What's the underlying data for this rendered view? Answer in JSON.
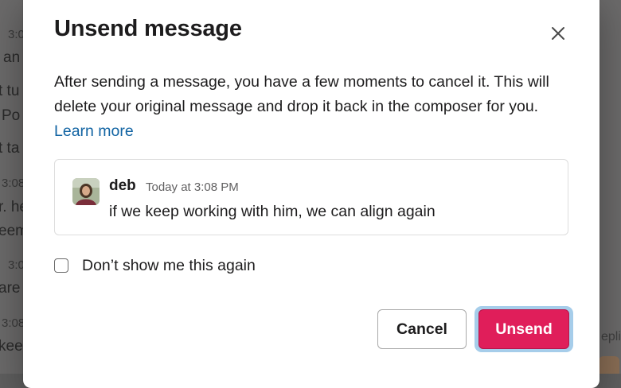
{
  "background": {
    "fragments": [
      {
        "text": "3:0",
        "kind": "time"
      },
      {
        "text": "an",
        "kind": "text"
      },
      {
        "text": "t tu",
        "kind": "text"
      },
      {
        "text": "Po",
        "kind": "text"
      },
      {
        "text": "t ta",
        "kind": "text"
      },
      {
        "text": "3:08",
        "kind": "time"
      },
      {
        "text": "r. he",
        "kind": "text"
      },
      {
        "text": "eem",
        "kind": "text"
      },
      {
        "text": "3:0",
        "kind": "time"
      },
      {
        "text": "are",
        "kind": "text"
      },
      {
        "text": "3:08",
        "kind": "time"
      },
      {
        "text": "keep",
        "kind": "text"
      },
      {
        "text": "eplie",
        "kind": "right"
      }
    ]
  },
  "dialog": {
    "title": "Unsend message",
    "close_icon": "close-x-icon",
    "description": "After sending a message, you have a few moments to cancel it. This will delete your original message and drop it back in the composer for you.",
    "learn_more": "Learn more",
    "message": {
      "author": "deb",
      "timestamp": "Today at 3:08 PM",
      "text": "if we keep working with him, we can align again"
    },
    "checkbox_label": "Don’t show me this again",
    "checkbox_checked": false,
    "cancel_label": "Cancel",
    "confirm_label": "Unsend"
  },
  "colors": {
    "danger": "#e01e5a",
    "link": "#1264a3",
    "focus_ring": "#a6cdea"
  }
}
